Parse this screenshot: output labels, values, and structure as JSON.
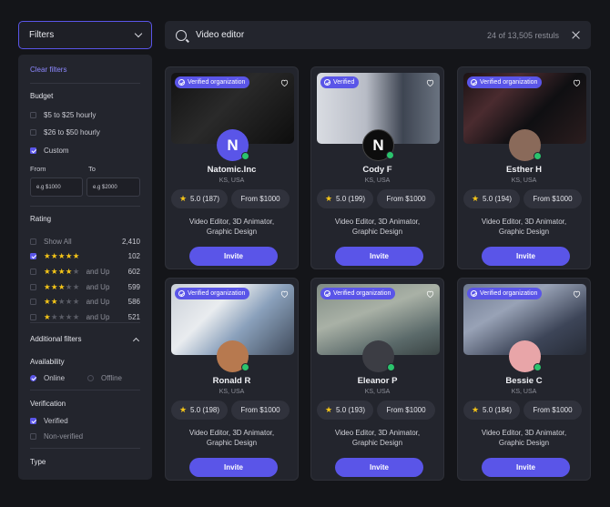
{
  "filters_label": "Filters",
  "search": {
    "query": "Video editor",
    "results": "24 of 13,505 restuls"
  },
  "sidebar": {
    "clear": "Clear filters",
    "budget": {
      "title": "Budget",
      "options": [
        {
          "label": "$5 to $25 hourly",
          "checked": false
        },
        {
          "label": "$26 to $50 hourly",
          "checked": false
        },
        {
          "label": "Custom",
          "checked": true
        }
      ],
      "from_label": "From",
      "to_label": "To",
      "from_placeholder": "e.g $1000",
      "to_placeholder": "e.g $2000"
    },
    "rating": {
      "title": "Rating",
      "rows": [
        {
          "label": "Show All",
          "count": "2,410",
          "stars": 0,
          "checked": false,
          "suffix": ""
        },
        {
          "label": "",
          "count": "102",
          "stars": 5,
          "checked": true,
          "suffix": ""
        },
        {
          "label": "",
          "count": "602",
          "stars": 4,
          "checked": false,
          "suffix": "and Up"
        },
        {
          "label": "",
          "count": "599",
          "stars": 3,
          "checked": false,
          "suffix": "and Up"
        },
        {
          "label": "",
          "count": "586",
          "stars": 2,
          "checked": false,
          "suffix": "and Up"
        },
        {
          "label": "",
          "count": "521",
          "stars": 1,
          "checked": false,
          "suffix": "and Up"
        }
      ]
    },
    "additional": "Additional filters",
    "availability": {
      "title": "Availability",
      "online": "Online",
      "offline": "Offline"
    },
    "verification": {
      "title": "Verification",
      "verified": "Verified",
      "non_verified": "Non-verified"
    },
    "type": "Type"
  },
  "cards": [
    {
      "name": "Natomic.Inc",
      "location": "KS, USA",
      "badge": "Verified organization",
      "avatar": "N",
      "rating": "5.0 (187)",
      "price": "From $1000",
      "desc": [
        "Video Editor, 3D Animator,",
        "Graphic Design"
      ],
      "invite": "Invite"
    },
    {
      "name": "Cody F",
      "location": "KS, USA",
      "badge": "Verified",
      "avatar": "N",
      "rating": "5.0 (199)",
      "price": "From $1000",
      "desc": [
        "Video Editor, 3D Animator,",
        "Graphic Design"
      ],
      "invite": "Invite"
    },
    {
      "name": "Esther H",
      "location": "KS, USA",
      "badge": "Verified organization",
      "avatar": "",
      "rating": "5.0 (194)",
      "price": "From $1000",
      "desc": [
        "Video Editor, 3D Animator,",
        "Graphic Design"
      ],
      "invite": "Invite"
    },
    {
      "name": "Ronald R",
      "location": "KS, USA",
      "badge": "Verified organization",
      "avatar": "",
      "rating": "5.0 (198)",
      "price": "From $1000",
      "desc": [
        "Video Editor, 3D Animator,",
        "Graphic Design"
      ],
      "invite": "Invite"
    },
    {
      "name": "Eleanor P",
      "location": "KS, USA",
      "badge": "Verified organization",
      "avatar": "",
      "rating": "5.0 (193)",
      "price": "From $1000",
      "desc": [
        "Video Editor, 3D Animator,",
        "Graphic Design"
      ],
      "invite": "Invite"
    },
    {
      "name": "Bessie C",
      "location": "KS, USA",
      "badge": "Verified organization",
      "avatar": "",
      "rating": "5.0 (184)",
      "price": "From $1000",
      "desc": [
        "Video Editor, 3D Animator,",
        "Graphic Design"
      ],
      "invite": "Invite"
    }
  ],
  "colors": {
    "accent": "#5a55e8",
    "online": "#2bc46d",
    "star": "#f5c518",
    "panel": "#23252d",
    "background": "#141519"
  }
}
